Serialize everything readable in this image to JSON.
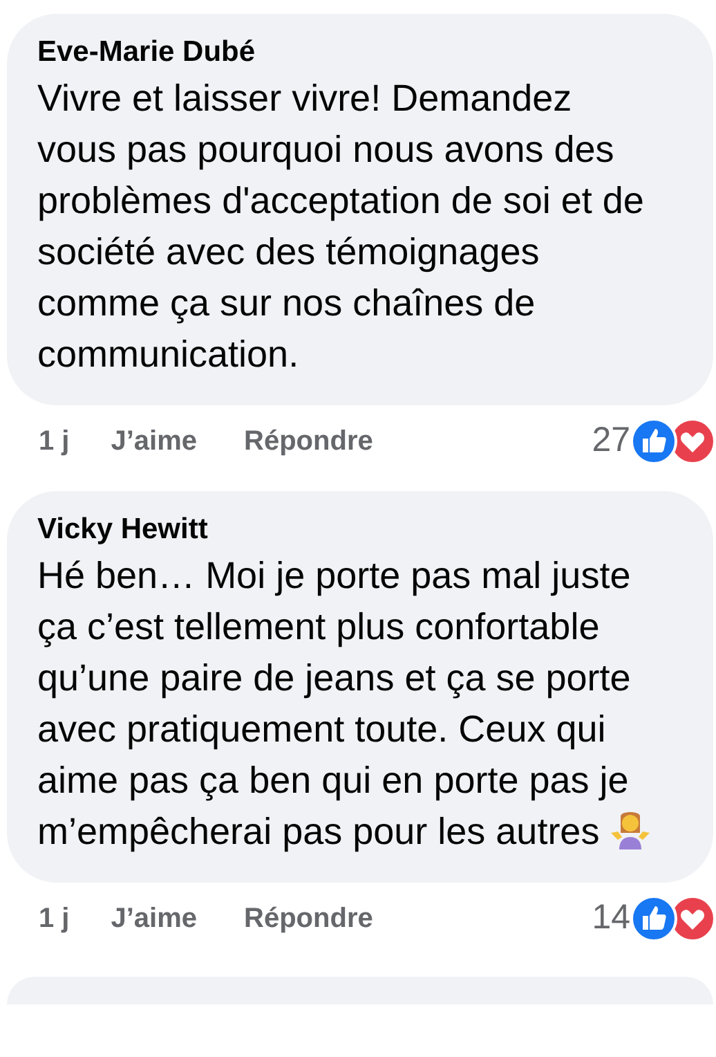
{
  "comments": [
    {
      "author": "Eve-Marie Dubé",
      "text": "Vivre et laisser vivre! Demandez vous pas pourquoi nous avons des problèmes d'acceptation de soi et de société avec des témoignages comme ça sur nos chaînes de communication.",
      "emoji": false,
      "time": "1 j",
      "like_label": "J’aime",
      "reply_label": "Répondre",
      "reaction_count": "27"
    },
    {
      "author": "Vicky Hewitt",
      "text": "Hé ben… Moi je porte pas mal juste ça c’est tellement plus confortable qu’une paire de jeans et ça se porte avec pratiquement toute. Ceux qui aime pas ça ben qui en porte pas je m’empêcherai pas pour les autres",
      "emoji": true,
      "time": "1 j",
      "like_label": "J’aime",
      "reply_label": "Répondre",
      "reaction_count": "14"
    }
  ],
  "next_comment_partly_visible": true
}
